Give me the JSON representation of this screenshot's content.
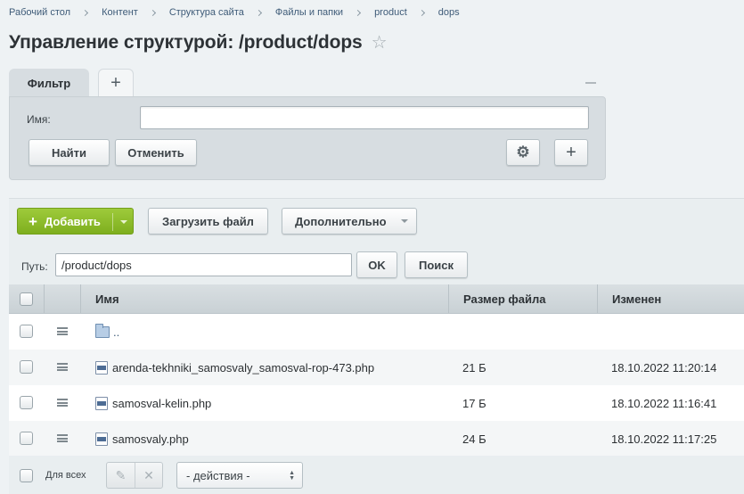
{
  "breadcrumb": [
    "Рабочий стол",
    "Контент",
    "Структура сайта",
    "Файлы и папки",
    "product",
    "dops"
  ],
  "page_title": "Управление структурой: /product/dops",
  "filter": {
    "tab_label": "Фильтр",
    "add_tab_label": "+",
    "name_label": "Имя:",
    "name_value": "",
    "find_label": "Найти",
    "cancel_label": "Отменить"
  },
  "toolbar": {
    "add_label": "Добавить",
    "upload_label": "Загрузить файл",
    "more_label": "Дополнительно"
  },
  "path": {
    "label": "Путь:",
    "value": "/product/dops",
    "ok_label": "OK",
    "search_label": "Поиск"
  },
  "table": {
    "columns": [
      "Имя",
      "Размер файла",
      "Изменен"
    ],
    "rows": [
      {
        "name": "..",
        "size": "",
        "modified": "",
        "type": "folder-up"
      },
      {
        "name": "arenda-tekhniki_samosvaly_samosval-rop-473.php",
        "size": "21 Б",
        "modified": "18.10.2022 11:20:14",
        "type": "php"
      },
      {
        "name": "samosval-kelin.php",
        "size": "17 Б",
        "modified": "18.10.2022 11:16:41",
        "type": "php"
      },
      {
        "name": "samosvaly.php",
        "size": "24 Б",
        "modified": "18.10.2022 11:17:25",
        "type": "php"
      }
    ]
  },
  "footer": {
    "for_all_label": "Для всех",
    "actions_select": "- действия -"
  },
  "icons": {
    "favorite": "star-icon",
    "settings": "gear-icon",
    "add": "plus-icon",
    "collapse": "minus-icon",
    "row_menu": "hamburger-icon",
    "edit": "pencil-icon",
    "delete": "close-icon"
  },
  "colors": {
    "accent_green": "#86b72b",
    "background": "#eef2f4",
    "link": "#3e5b78"
  }
}
